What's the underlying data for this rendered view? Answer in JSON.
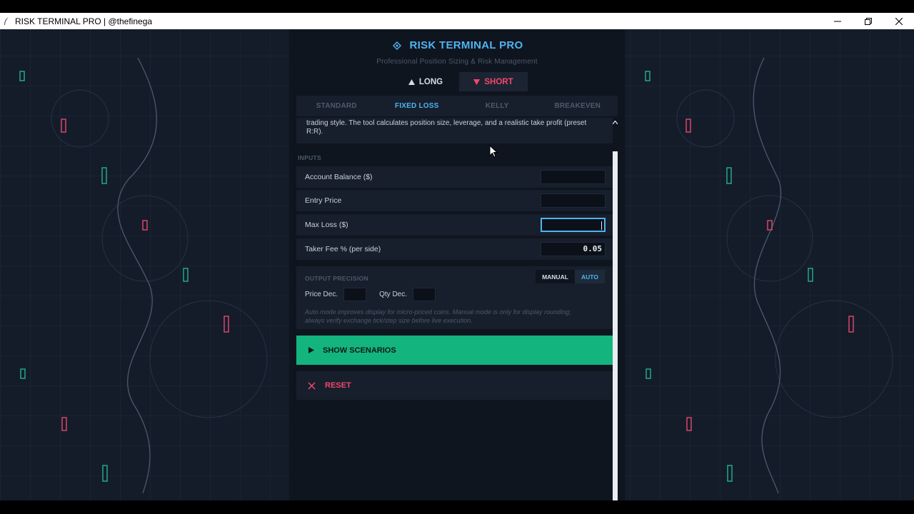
{
  "window": {
    "title": "RISK TERMINAL PRO | @thefinega",
    "buttons": [
      "minimize",
      "maximize",
      "close"
    ]
  },
  "header": {
    "title": "RISK TERMINAL PRO",
    "subtitle": "Professional Position Sizing & Risk Management",
    "icon": "diamond-icon"
  },
  "direction": {
    "long_label": "LONG",
    "short_label": "SHORT",
    "selected": "SHORT"
  },
  "tabs": [
    {
      "label": "STANDARD",
      "active": false
    },
    {
      "label": "FIXED LOSS",
      "active": true
    },
    {
      "label": "KELLY",
      "active": false
    },
    {
      "label": "BREAKEVEN",
      "active": false
    }
  ],
  "description": "trading style. The tool calculates position size, leverage, and a realistic take profit (preset R:R).",
  "inputs": {
    "section_label": "INPUTS",
    "fields": [
      {
        "label": "Account Balance ($)",
        "value": ""
      },
      {
        "label": "Entry Price",
        "value": ""
      },
      {
        "label": "Max Loss ($)",
        "value": "",
        "focused": true
      },
      {
        "label": "Taker Fee % (per side)",
        "value": "0.05"
      }
    ]
  },
  "precision": {
    "label": "OUTPUT PRECISION",
    "manual_label": "MANUAL",
    "auto_label": "AUTO",
    "selected": "AUTO",
    "price_dec_label": "Price Dec.",
    "qty_dec_label": "Qty Dec.",
    "price_dec_value": "",
    "qty_dec_value": "",
    "note": "Auto mode improves display for micro-priced coins. Manual mode is only for display rounding; always verify exchange tick/step size before live execution."
  },
  "actions": {
    "scenarios_label": "SHOW SCENARIOS",
    "reset_label": "RESET"
  },
  "colors": {
    "accent": "#4fb3f0",
    "short": "#f2476b",
    "green": "#14b47f",
    "panel": "#0f151f",
    "card": "#171f2c",
    "background": "#141c29"
  }
}
